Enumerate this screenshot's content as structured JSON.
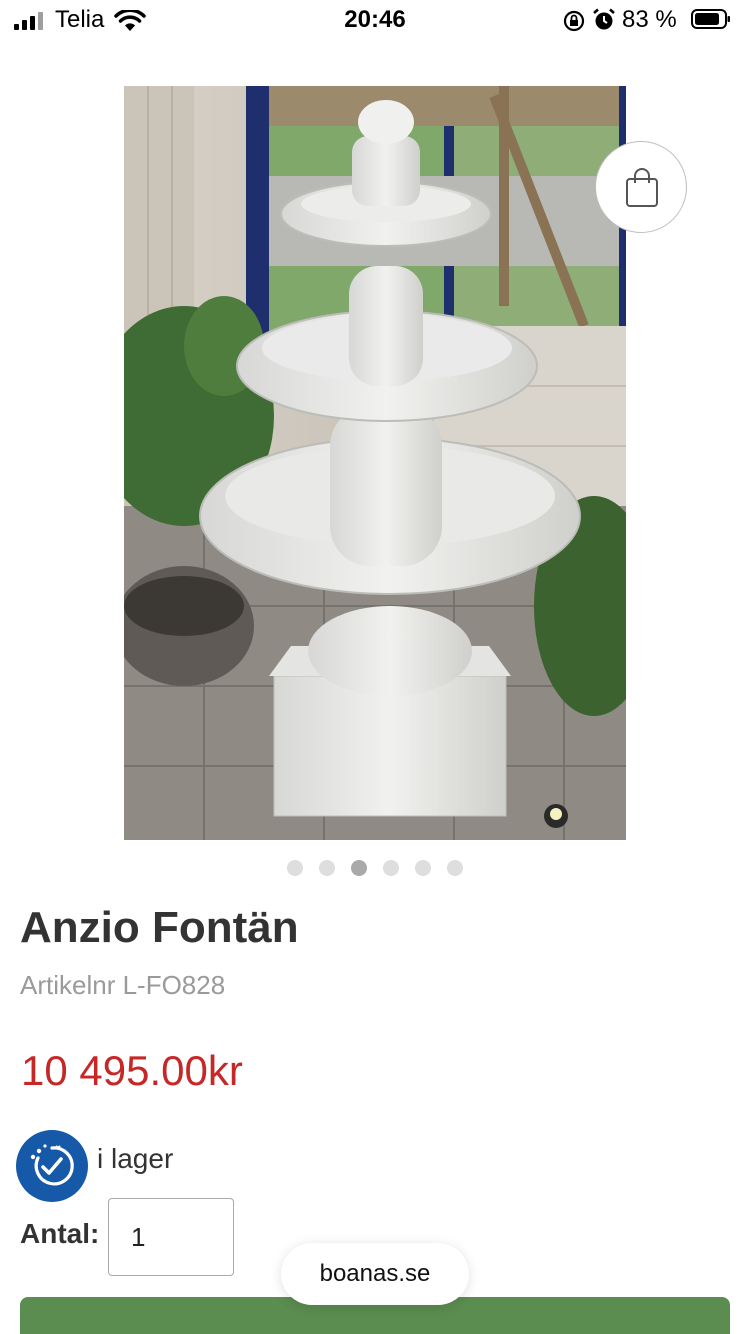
{
  "status_bar": {
    "carrier": "Telia",
    "time": "20:46",
    "battery_percent": "83 %",
    "icons": [
      "signal-icon",
      "wifi-icon",
      "rotation-lock-icon",
      "alarm-icon",
      "battery-icon"
    ]
  },
  "product": {
    "image_subject": "fountain-photo",
    "title": "Anzio Fontän",
    "article_number": "Artikelnr L-FO828",
    "price": "10 495.00kr",
    "stock_status": "i lager",
    "quantity_label": "Antal:",
    "quantity_value": "1"
  },
  "carousel": {
    "total_images": 6,
    "active_index": 2
  },
  "browser": {
    "domain": "boanas.se"
  },
  "colors": {
    "price": "#c62828",
    "stock_badge": "#1559a8",
    "buy_button": "#5b8c50",
    "dot_active": "#a9a9a9",
    "dot_inactive": "#dedede"
  }
}
